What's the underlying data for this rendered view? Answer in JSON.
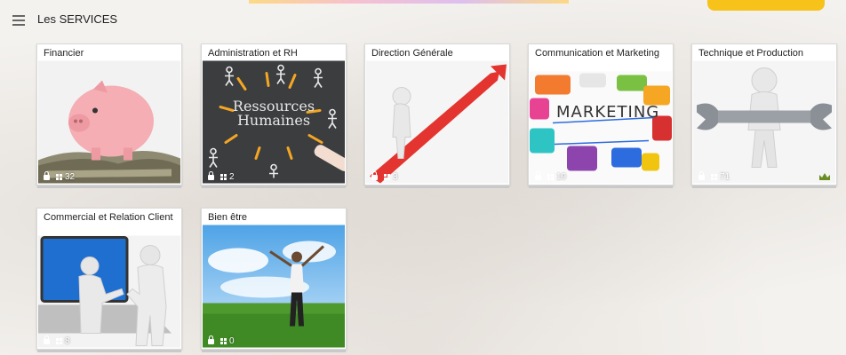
{
  "header": {
    "title": "Les SERVICES"
  },
  "cards": [
    {
      "title": "Financier",
      "count": "32"
    },
    {
      "title": "Administration et RH",
      "count": "2",
      "image_text": "Ressources Humaines"
    },
    {
      "title": "Direction Générale",
      "count": "3"
    },
    {
      "title": "Communication et Marketing",
      "count": "19",
      "image_text": "MARKETING"
    },
    {
      "title": "Technique et Production",
      "count": "71"
    },
    {
      "title": "Commercial et Relation Client",
      "count": "8"
    },
    {
      "title": "Bien être",
      "count": "0"
    }
  ],
  "icons": {
    "menu": "menu-icon",
    "lock": "lock-icon",
    "grid": "grid-icon",
    "crown": "crown-icon"
  },
  "colors": {
    "accent_yellow": "#f7c21a",
    "crown": "#6b8e23"
  }
}
